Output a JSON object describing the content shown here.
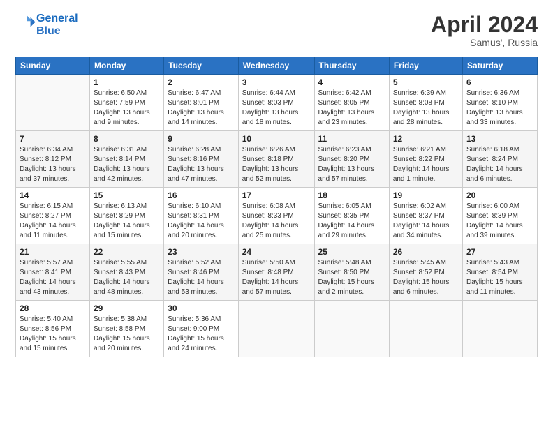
{
  "header": {
    "logo_line1": "General",
    "logo_line2": "Blue",
    "month": "April 2024",
    "location": "Samus', Russia"
  },
  "days_of_week": [
    "Sunday",
    "Monday",
    "Tuesday",
    "Wednesday",
    "Thursday",
    "Friday",
    "Saturday"
  ],
  "weeks": [
    [
      {
        "num": "",
        "info": ""
      },
      {
        "num": "1",
        "info": "Sunrise: 6:50 AM\nSunset: 7:59 PM\nDaylight: 13 hours\nand 9 minutes."
      },
      {
        "num": "2",
        "info": "Sunrise: 6:47 AM\nSunset: 8:01 PM\nDaylight: 13 hours\nand 14 minutes."
      },
      {
        "num": "3",
        "info": "Sunrise: 6:44 AM\nSunset: 8:03 PM\nDaylight: 13 hours\nand 18 minutes."
      },
      {
        "num": "4",
        "info": "Sunrise: 6:42 AM\nSunset: 8:05 PM\nDaylight: 13 hours\nand 23 minutes."
      },
      {
        "num": "5",
        "info": "Sunrise: 6:39 AM\nSunset: 8:08 PM\nDaylight: 13 hours\nand 28 minutes."
      },
      {
        "num": "6",
        "info": "Sunrise: 6:36 AM\nSunset: 8:10 PM\nDaylight: 13 hours\nand 33 minutes."
      }
    ],
    [
      {
        "num": "7",
        "info": "Sunrise: 6:34 AM\nSunset: 8:12 PM\nDaylight: 13 hours\nand 37 minutes."
      },
      {
        "num": "8",
        "info": "Sunrise: 6:31 AM\nSunset: 8:14 PM\nDaylight: 13 hours\nand 42 minutes."
      },
      {
        "num": "9",
        "info": "Sunrise: 6:28 AM\nSunset: 8:16 PM\nDaylight: 13 hours\nand 47 minutes."
      },
      {
        "num": "10",
        "info": "Sunrise: 6:26 AM\nSunset: 8:18 PM\nDaylight: 13 hours\nand 52 minutes."
      },
      {
        "num": "11",
        "info": "Sunrise: 6:23 AM\nSunset: 8:20 PM\nDaylight: 13 hours\nand 57 minutes."
      },
      {
        "num": "12",
        "info": "Sunrise: 6:21 AM\nSunset: 8:22 PM\nDaylight: 14 hours\nand 1 minute."
      },
      {
        "num": "13",
        "info": "Sunrise: 6:18 AM\nSunset: 8:24 PM\nDaylight: 14 hours\nand 6 minutes."
      }
    ],
    [
      {
        "num": "14",
        "info": "Sunrise: 6:15 AM\nSunset: 8:27 PM\nDaylight: 14 hours\nand 11 minutes."
      },
      {
        "num": "15",
        "info": "Sunrise: 6:13 AM\nSunset: 8:29 PM\nDaylight: 14 hours\nand 15 minutes."
      },
      {
        "num": "16",
        "info": "Sunrise: 6:10 AM\nSunset: 8:31 PM\nDaylight: 14 hours\nand 20 minutes."
      },
      {
        "num": "17",
        "info": "Sunrise: 6:08 AM\nSunset: 8:33 PM\nDaylight: 14 hours\nand 25 minutes."
      },
      {
        "num": "18",
        "info": "Sunrise: 6:05 AM\nSunset: 8:35 PM\nDaylight: 14 hours\nand 29 minutes."
      },
      {
        "num": "19",
        "info": "Sunrise: 6:02 AM\nSunset: 8:37 PM\nDaylight: 14 hours\nand 34 minutes."
      },
      {
        "num": "20",
        "info": "Sunrise: 6:00 AM\nSunset: 8:39 PM\nDaylight: 14 hours\nand 39 minutes."
      }
    ],
    [
      {
        "num": "21",
        "info": "Sunrise: 5:57 AM\nSunset: 8:41 PM\nDaylight: 14 hours\nand 43 minutes."
      },
      {
        "num": "22",
        "info": "Sunrise: 5:55 AM\nSunset: 8:43 PM\nDaylight: 14 hours\nand 48 minutes."
      },
      {
        "num": "23",
        "info": "Sunrise: 5:52 AM\nSunset: 8:46 PM\nDaylight: 14 hours\nand 53 minutes."
      },
      {
        "num": "24",
        "info": "Sunrise: 5:50 AM\nSunset: 8:48 PM\nDaylight: 14 hours\nand 57 minutes."
      },
      {
        "num": "25",
        "info": "Sunrise: 5:48 AM\nSunset: 8:50 PM\nDaylight: 15 hours\nand 2 minutes."
      },
      {
        "num": "26",
        "info": "Sunrise: 5:45 AM\nSunset: 8:52 PM\nDaylight: 15 hours\nand 6 minutes."
      },
      {
        "num": "27",
        "info": "Sunrise: 5:43 AM\nSunset: 8:54 PM\nDaylight: 15 hours\nand 11 minutes."
      }
    ],
    [
      {
        "num": "28",
        "info": "Sunrise: 5:40 AM\nSunset: 8:56 PM\nDaylight: 15 hours\nand 15 minutes."
      },
      {
        "num": "29",
        "info": "Sunrise: 5:38 AM\nSunset: 8:58 PM\nDaylight: 15 hours\nand 20 minutes."
      },
      {
        "num": "30",
        "info": "Sunrise: 5:36 AM\nSunset: 9:00 PM\nDaylight: 15 hours\nand 24 minutes."
      },
      {
        "num": "",
        "info": ""
      },
      {
        "num": "",
        "info": ""
      },
      {
        "num": "",
        "info": ""
      },
      {
        "num": "",
        "info": ""
      }
    ]
  ]
}
